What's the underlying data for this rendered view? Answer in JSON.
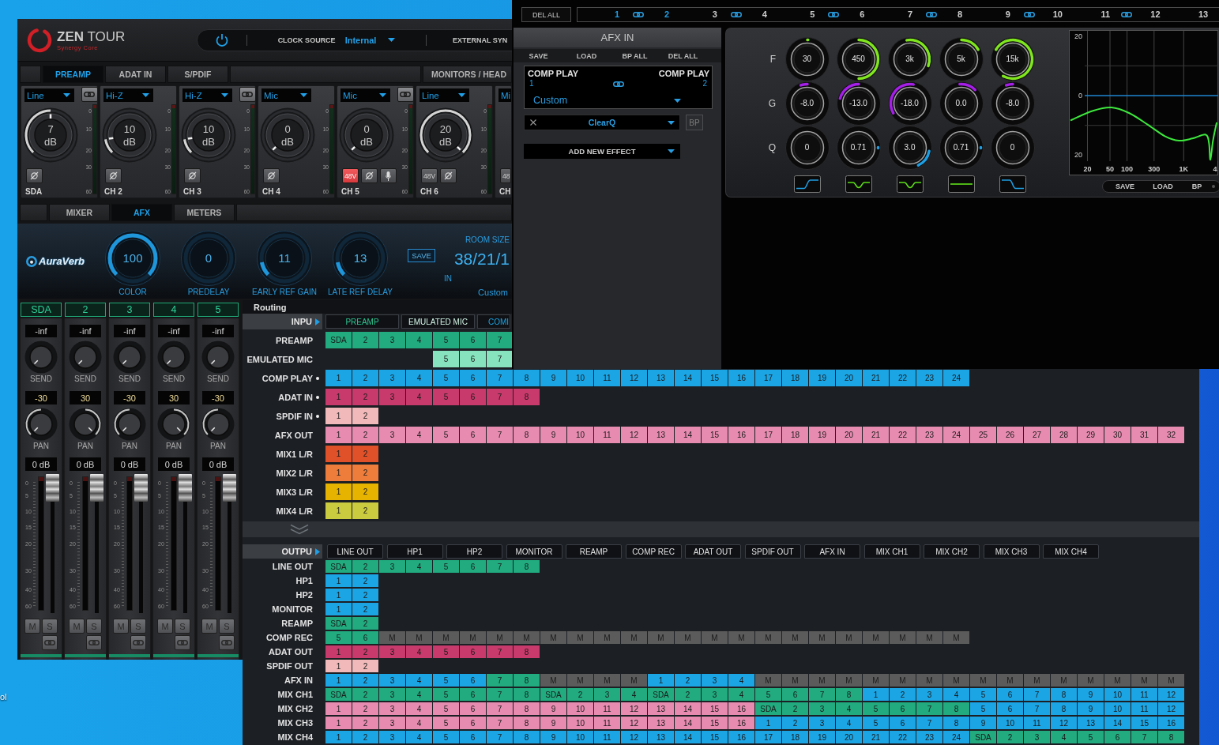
{
  "desktop": {
    "icon_labels": [
      "ol"
    ]
  },
  "main_window": {
    "logo": {
      "title": "**ZEN** TOUR",
      "subtitle": "Synergy Core"
    },
    "power": {
      "on": true
    },
    "clock_source": {
      "label": "CLOCK SOURCE",
      "value": "Internal"
    },
    "external_sync": {
      "label": "EXTERNAL SYN"
    },
    "tabs": [
      {
        "label": "PREAMP",
        "selected": true
      },
      {
        "label": "ADAT IN",
        "selected": false
      },
      {
        "label": "S/PDIF",
        "selected": false
      },
      {
        "label": "MONITORS / HEAD",
        "selected": false
      }
    ],
    "preamp_strips": [
      {
        "input": "Line",
        "link": true,
        "gain": {
          "value": "7",
          "unit": "dB",
          "kind": "mid"
        },
        "meter_scale": [
          "0",
          "10",
          "20",
          "30",
          "60"
        ],
        "phase_invert": false,
        "mic": false,
        "label": "SDA"
      },
      {
        "input": "Hi-Z",
        "link": false,
        "gain": {
          "value": "10",
          "unit": "dB",
          "kind": "low"
        },
        "meter_scale": [
          "0",
          "10",
          "20",
          "30",
          "60"
        ],
        "phase_invert": false,
        "mic": false,
        "label": "CH 2"
      },
      {
        "input": "Hi-Z",
        "link": true,
        "gain": {
          "value": "10",
          "unit": "dB",
          "kind": "low"
        },
        "meter_scale": [
          "0",
          "10",
          "20",
          "30",
          "60"
        ],
        "phase_invert": false,
        "mic": false,
        "label": "CH 3"
      },
      {
        "input": "Mic",
        "link": false,
        "gain": {
          "value": "0",
          "unit": "dB",
          "kind": "min"
        },
        "meter_scale": [
          "0",
          "10",
          "20",
          "30",
          "60"
        ],
        "phase_invert": false,
        "mic": false,
        "label": "CH 4"
      },
      {
        "input": "Mic",
        "link": true,
        "gain": {
          "value": "0",
          "unit": "dB",
          "kind": "min"
        },
        "meter_scale": [
          "0",
          "10",
          "20",
          "30",
          "60"
        ],
        "phantom": {
          "label": "48V",
          "on": true
        },
        "phase_invert": false,
        "mic": true,
        "label": "CH 5"
      },
      {
        "input": "Line",
        "link": false,
        "gain": {
          "value": "20",
          "unit": "dB",
          "kind": "max"
        },
        "meter_scale": [
          "0",
          "10",
          "20",
          "30",
          "60"
        ],
        "phantom": {
          "label": "48V",
          "on": false
        },
        "phase_invert": false,
        "mic": false,
        "label": "CH 6"
      },
      {
        "input": "Mi",
        "link": false,
        "phantom": {
          "label": "48",
          "on": false
        },
        "mic": false,
        "label": "CH"
      }
    ],
    "view_tabs": [
      {
        "label": "MIXER",
        "selected": false
      },
      {
        "label": "AFX",
        "selected": true
      },
      {
        "label": "METERS",
        "selected": false
      }
    ],
    "reverb": {
      "logo": "AuraVerb",
      "knobs": [
        {
          "value": "100",
          "label": "COLOR",
          "kind": "max"
        },
        {
          "value": "0",
          "label": "PREDELAY",
          "kind": "min"
        },
        {
          "value": "11",
          "label": "EARLY REF GAIN",
          "kind": "low"
        },
        {
          "value": "13",
          "label": "LATE REF DELAY",
          "kind": "low"
        }
      ],
      "save": "SAVE",
      "room_size": {
        "label": "ROOM SIZE",
        "value": "38/21/1"
      },
      "input_label": "IN",
      "preset": "Custom"
    },
    "mixer_strips": [
      {
        "label": "SDA",
        "level_reading": "-inf",
        "send": {
          "label": "SEND",
          "kind": "min"
        },
        "pan": {
          "reading": "-30",
          "label": "PAN",
          "kind": "left"
        },
        "gain_reading": "0 dB",
        "fader_scale": [
          "0",
          "5",
          "10",
          "15",
          "20",
          "30",
          "40",
          "60"
        ],
        "fader": {
          "level": 1
        },
        "mute": {
          "label": "M",
          "on": false
        },
        "solo": {
          "label": "S",
          "on": false
        }
      },
      {
        "label": "2",
        "level_reading": "-inf",
        "send": {
          "label": "SEND",
          "kind": "min"
        },
        "pan": {
          "reading": "30",
          "label": "PAN",
          "kind": "right"
        },
        "gain_reading": "0 dB",
        "fader_scale": [
          "0",
          "5",
          "10",
          "15",
          "20",
          "30",
          "40",
          "60"
        ],
        "fader": {
          "level": 1
        },
        "mute": {
          "label": "M",
          "on": false
        },
        "solo": {
          "label": "S",
          "on": false
        }
      },
      {
        "label": "3",
        "level_reading": "-inf",
        "send": {
          "label": "SEND",
          "kind": "min"
        },
        "pan": {
          "reading": "-30",
          "label": "PAN",
          "kind": "left"
        },
        "gain_reading": "0 dB",
        "fader_scale": [
          "0",
          "5",
          "10",
          "15",
          "20",
          "30",
          "40",
          "60"
        ],
        "fader": {
          "level": 1
        },
        "mute": {
          "label": "M",
          "on": false
        },
        "solo": {
          "label": "S",
          "on": false
        }
      },
      {
        "label": "4",
        "level_reading": "-inf",
        "send": {
          "label": "SEND",
          "kind": "min"
        },
        "pan": {
          "reading": "30",
          "label": "PAN",
          "kind": "right"
        },
        "gain_reading": "0 dB",
        "fader_scale": [
          "0",
          "5",
          "10",
          "15",
          "20",
          "30",
          "40",
          "60"
        ],
        "fader": {
          "level": 1
        },
        "mute": {
          "label": "M",
          "on": false
        },
        "solo": {
          "label": "S",
          "on": false
        }
      },
      {
        "label": "5",
        "level_reading": "-inf",
        "send": {
          "label": "SEND",
          "kind": "min"
        },
        "pan": {
          "reading": "-30",
          "label": "PAN",
          "kind": "left"
        },
        "gain_reading": "0 dB",
        "fader_scale": [
          "0",
          "5",
          "10",
          "15",
          "20",
          "30",
          "40",
          "60"
        ],
        "fader": {
          "level": 1
        },
        "mute": {
          "label": "M",
          "on": false
        },
        "solo": {
          "label": "S",
          "on": false
        }
      }
    ]
  },
  "routing": {
    "title": "Routing",
    "inputs": {
      "header": "INPU",
      "tabs": [
        {
          "label": "PREAMP",
          "color": "#2fc48f"
        },
        {
          "label": "EMULATED MIC",
          "color": "#d4f5e6"
        },
        {
          "label": "COMI",
          "color": "#1ca5e5"
        }
      ],
      "rows": [
        {
          "label": "PREAMP",
          "marked": false,
          "segments": [
            {
              "kind": "channels",
              "color": "#21ab7f",
              "cells": [
                "SDA",
                "2",
                "3",
                "4",
                "5",
                "6",
                "7"
              ]
            }
          ]
        },
        {
          "label": "EMULATED MIC",
          "marked": false,
          "segments": [
            {
              "kind": "gap"
            },
            {
              "kind": "gap"
            },
            {
              "kind": "gap"
            },
            {
              "kind": "gap"
            },
            {
              "kind": "channels",
              "color": "#87e3bd",
              "cells": [
                "5",
                "6",
                "7"
              ]
            }
          ]
        },
        {
          "label": "COMP PLAY",
          "marked": true,
          "segments": [
            {
              "kind": "channels",
              "color": "#1ca5e5",
              "cells": [
                "1",
                "2",
                "3",
                "4",
                "5",
                "6",
                "7",
                "8",
                "9",
                "10",
                "11",
                "12",
                "13",
                "14",
                "15",
                "16",
                "17",
                "18",
                "19",
                "20",
                "21",
                "22",
                "23",
                "24"
              ]
            }
          ]
        },
        {
          "label": "ADAT IN",
          "marked": true,
          "segments": [
            {
              "kind": "channels",
              "color": "#c73a6b",
              "cells": [
                "1",
                "2",
                "3",
                "4",
                "5",
                "6",
                "7",
                "8"
              ]
            }
          ]
        },
        {
          "label": "SPDIF IN",
          "marked": true,
          "segments": [
            {
              "kind": "channels",
              "color": "#f1b9b9",
              "cells": [
                "1",
                "2"
              ]
            }
          ]
        },
        {
          "label": "AFX OUT",
          "marked": false,
          "segments": [
            {
              "kind": "channels",
              "color": "#e78cb0",
              "cells": [
                "1",
                "2",
                "3",
                "4",
                "5",
                "6",
                "7",
                "8",
                "9",
                "10",
                "11",
                "12",
                "13",
                "14",
                "15",
                "16",
                "17",
                "18",
                "19",
                "20",
                "21",
                "22",
                "23",
                "24",
                "25",
                "26",
                "27",
                "28",
                "29",
                "30",
                "31",
                "32"
              ]
            }
          ]
        },
        {
          "label": "MIX1 L/R",
          "marked": false,
          "segments": [
            {
              "kind": "channels",
              "color": "#e0512a",
              "cells": [
                "1",
                "2"
              ]
            }
          ]
        },
        {
          "label": "MIX2 L/R",
          "marked": false,
          "segments": [
            {
              "kind": "channels",
              "color": "#ee7d3c",
              "cells": [
                "1",
                "2"
              ]
            }
          ]
        },
        {
          "label": "MIX3 L/R",
          "marked": false,
          "segments": [
            {
              "kind": "channels",
              "color": "#e6b300",
              "cells": [
                "1",
                "2"
              ]
            }
          ]
        },
        {
          "label": "MIX4 L/R",
          "marked": false,
          "segments": [
            {
              "kind": "channels",
              "color": "#cbcb3f",
              "cells": [
                "1",
                "2"
              ]
            }
          ]
        }
      ]
    },
    "outputs": {
      "header": "OUTPU",
      "tabs": [
        {
          "label": "LINE OUT"
        },
        {
          "label": "HP1"
        },
        {
          "label": "HP2"
        },
        {
          "label": "MONITOR"
        },
        {
          "label": "REAMP"
        },
        {
          "label": "COMP REC"
        },
        {
          "label": "ADAT OUT"
        },
        {
          "label": "SPDIF OUT"
        },
        {
          "label": "AFX IN"
        },
        {
          "label": "MIX CH1"
        },
        {
          "label": "MIX CH2"
        },
        {
          "label": "MIX CH3"
        },
        {
          "label": "MIX CH4"
        }
      ],
      "rows": [
        {
          "label": "LINE OUT",
          "segments": [
            {
              "kind": "channels",
              "color": "#21ab7f",
              "cells": [
                "SDA",
                "2",
                "3",
                "4",
                "5",
                "6",
                "7",
                "8"
              ]
            }
          ]
        },
        {
          "label": "HP1",
          "segments": [
            {
              "kind": "channels",
              "color": "#1ca5e5",
              "cells": [
                "1",
                "2"
              ]
            }
          ]
        },
        {
          "label": "HP2",
          "segments": [
            {
              "kind": "channels",
              "color": "#1ca5e5",
              "cells": [
                "1",
                "2"
              ]
            }
          ]
        },
        {
          "label": "MONITOR",
          "segments": [
            {
              "kind": "channels",
              "color": "#1ca5e5",
              "cells": [
                "1",
                "2"
              ]
            }
          ]
        },
        {
          "label": "REAMP",
          "segments": [
            {
              "kind": "channels",
              "color": "#21ab7f",
              "cells": [
                "SDA",
                "2"
              ]
            }
          ]
        },
        {
          "label": "COMP REC",
          "segments": [
            {
              "kind": "channels",
              "color": "#21ab7f",
              "cells": [
                "5",
                "6"
              ]
            },
            {
              "kind": "channels",
              "color": "#5b5b5b",
              "cells": [
                "M",
                "M",
                "M",
                "M",
                "M",
                "M",
                "M",
                "M",
                "M",
                "M",
                "M",
                "M",
                "M",
                "M",
                "M",
                "M",
                "M",
                "M",
                "M",
                "M",
                "M",
                "M"
              ]
            }
          ]
        },
        {
          "label": "ADAT OUT",
          "segments": [
            {
              "kind": "channels",
              "color": "#c73a6b",
              "cells": [
                "1",
                "2",
                "3",
                "4",
                "5",
                "6",
                "7",
                "8"
              ]
            }
          ]
        },
        {
          "label": "SPDIF OUT",
          "segments": [
            {
              "kind": "channels",
              "color": "#f1b9b9",
              "cells": [
                "1",
                "2"
              ]
            }
          ]
        },
        {
          "label": "AFX IN",
          "segments": [
            {
              "kind": "channels",
              "color": "#1ca5e5",
              "cells": [
                "1",
                "2",
                "3",
                "4",
                "5",
                "6"
              ]
            },
            {
              "kind": "channels",
              "color": "#21ab7f",
              "cells": [
                "7",
                "8"
              ]
            },
            {
              "kind": "channels",
              "color": "#5b5b5b",
              "cells": [
                "M",
                "M",
                "M",
                "M"
              ]
            },
            {
              "kind": "channels",
              "color": "#1ca5e5",
              "cells": [
                "1",
                "2",
                "3",
                "4"
              ]
            },
            {
              "kind": "channels",
              "color": "#5b5b5b",
              "cells": [
                "M",
                "M",
                "M",
                "M",
                "M",
                "M",
                "M",
                "M",
                "M",
                "M",
                "M",
                "M",
                "M",
                "M",
                "M",
                "M"
              ]
            }
          ]
        },
        {
          "label": "MIX CH1",
          "segments": [
            {
              "kind": "channels",
              "color": "#21ab7f",
              "cells": [
                "SDA",
                "2",
                "3",
                "4",
                "5",
                "6",
                "7",
                "8",
                "SDA",
                "2",
                "3",
                "4",
                "SDA",
                "2",
                "3",
                "4",
                "5",
                "6",
                "7",
                "8"
              ]
            },
            {
              "kind": "channels",
              "color": "#1ca5e5",
              "cells": [
                "1",
                "2",
                "3",
                "4",
                "5",
                "6",
                "7",
                "8",
                "9",
                "10",
                "11",
                "12"
              ]
            }
          ]
        },
        {
          "label": "MIX CH2",
          "segments": [
            {
              "kind": "channels",
              "color": "#e78cb0",
              "cells": [
                "1",
                "2",
                "3",
                "4",
                "5",
                "6",
                "7",
                "8",
                "9",
                "10",
                "11",
                "12",
                "13",
                "14",
                "15",
                "16"
              ]
            },
            {
              "kind": "channels",
              "color": "#21ab7f",
              "cells": [
                "SDA",
                "2",
                "3",
                "4",
                "5",
                "6",
                "7",
                "8"
              ]
            },
            {
              "kind": "channels",
              "color": "#1ca5e5",
              "cells": [
                "5",
                "6",
                "7",
                "8",
                "9",
                "10",
                "11",
                "12"
              ]
            }
          ]
        },
        {
          "label": "MIX CH3",
          "segments": [
            {
              "kind": "channels",
              "color": "#e78cb0",
              "cells": [
                "1",
                "2",
                "3",
                "4",
                "5",
                "6",
                "7",
                "8",
                "9",
                "10",
                "11",
                "12",
                "13",
                "14",
                "15",
                "16"
              ]
            },
            {
              "kind": "channels",
              "color": "#1ca5e5",
              "cells": [
                "1",
                "2",
                "3",
                "4",
                "5",
                "6",
                "7",
                "8",
                "9",
                "10",
                "11",
                "12",
                "13",
                "14",
                "15",
                "16"
              ]
            }
          ]
        },
        {
          "label": "MIX CH4",
          "segments": [
            {
              "kind": "channels",
              "color": "#1ca5e5",
              "cells": [
                "1",
                "2",
                "3",
                "4",
                "5",
                "6",
                "7",
                "8",
                "9",
                "10",
                "11",
                "12",
                "13",
                "14",
                "15",
                "16",
                "17",
                "18",
                "19",
                "20",
                "21",
                "22",
                "23",
                "24"
              ]
            },
            {
              "kind": "channels",
              "color": "#21ab7f",
              "cells": [
                "SDA",
                "2",
                "3",
                "4",
                "5",
                "6",
                "7",
                "8"
              ]
            }
          ]
        }
      ]
    }
  },
  "afx_window": {
    "delete_all": "DEL ALL",
    "channels": [
      {
        "label": "1",
        "selected": true
      },
      {
        "label": "2",
        "selected": true
      },
      {
        "label": "3",
        "selected": false
      },
      {
        "label": "4",
        "selected": false
      },
      {
        "label": "5",
        "selected": false
      },
      {
        "label": "6",
        "selected": false
      },
      {
        "label": "7",
        "selected": false
      },
      {
        "label": "8",
        "selected": false
      },
      {
        "label": "9",
        "selected": false
      },
      {
        "label": "10",
        "selected": false
      },
      {
        "label": "11",
        "selected": false
      },
      {
        "label": "12",
        "selected": false
      },
      {
        "label": "13",
        "selected": false
      }
    ],
    "panel": {
      "title": "AFX IN",
      "actions": [
        "SAVE",
        "LOAD",
        "BP ALL",
        "DEL ALL"
      ],
      "pair": {
        "left": {
          "name": "COMP PLAY",
          "channel": "1"
        },
        "right": {
          "name": "COMP PLAY",
          "channel": "2"
        },
        "preset": "Custom"
      },
      "effects": [
        {
          "name": "ClearQ",
          "bypass": {
            "label": "BP",
            "on": false
          }
        }
      ],
      "add_effect": "ADD NEW EFFECT"
    },
    "eq": {
      "rows": [
        {
          "label": "F",
          "kind": "frequency"
        },
        {
          "label": "G",
          "kind": "gain"
        },
        {
          "label": "Q",
          "kind": "q"
        }
      ],
      "bands": [
        {
          "kind": "high_pass",
          "knobs": [
            {
              "value": "30",
              "kind": "dot_top"
            },
            {
              "value": "-8.0",
              "kind": "cut_small"
            },
            {
              "value": "0"
            }
          ]
        },
        {
          "kind": "bell",
          "knobs": [
            {
              "value": "450",
              "kind": "half"
            },
            {
              "value": "-13.0",
              "kind": "cut"
            },
            {
              "value": "0.71",
              "kind": "dot_right"
            }
          ]
        },
        {
          "kind": "bell",
          "knobs": [
            {
              "value": "3k",
              "kind": "third"
            },
            {
              "value": "-18.0",
              "kind": "cut_large"
            },
            {
              "value": "3.0",
              "kind": "arc_right"
            }
          ]
        },
        {
          "kind": "flat",
          "knobs": [
            {
              "value": "5k",
              "kind": "sixth"
            },
            {
              "value": "0.0",
              "kind": "boost_small"
            },
            {
              "value": "0.71",
              "kind": "dot_right"
            }
          ]
        },
        {
          "kind": "low_pass",
          "knobs": [
            {
              "value": "15k",
              "kind": "wide"
            },
            {
              "value": "-8.0",
              "kind": "cut_small"
            },
            {
              "value": "0"
            }
          ]
        }
      ],
      "graph": {
        "y_labels": [
          "20",
          "0",
          "20"
        ],
        "x_labels": [
          "20",
          "50",
          "100",
          "300",
          "1K",
          "4"
        ]
      },
      "buttons": [
        "SAVE",
        "LOAD",
        "BP"
      ],
      "bypass": false
    }
  }
}
